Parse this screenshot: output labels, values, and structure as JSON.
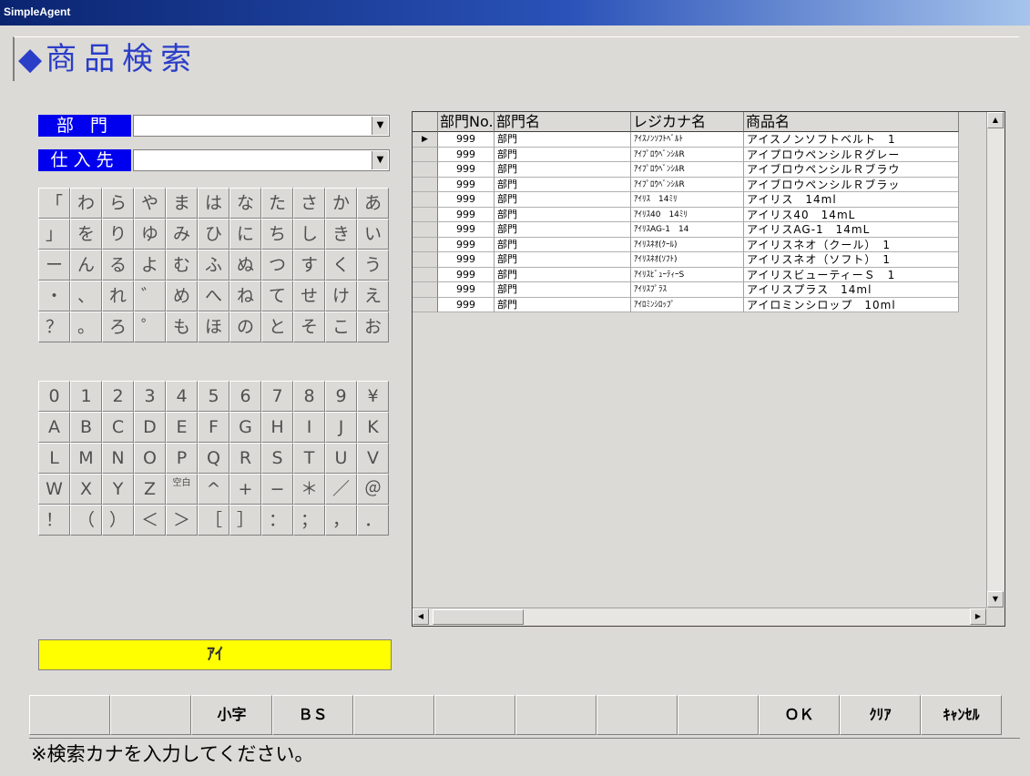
{
  "window": {
    "title": "SimpleAgent"
  },
  "page": {
    "title": "商品検索"
  },
  "filters": {
    "dept_label": "部 門",
    "dept_value": "",
    "supplier_label": "仕入先",
    "supplier_value": ""
  },
  "kana_keys": [
    [
      "「",
      "わ",
      "ら",
      "や",
      "ま",
      "は",
      "な",
      "た",
      "さ",
      "か",
      "あ"
    ],
    [
      "」",
      "を",
      "り",
      "ゆ",
      "み",
      "ひ",
      "に",
      "ち",
      "し",
      "き",
      "い"
    ],
    [
      "ー",
      "ん",
      "る",
      "よ",
      "む",
      "ふ",
      "ぬ",
      "つ",
      "す",
      "く",
      "う"
    ],
    [
      "・",
      "、",
      "れ",
      "゛",
      "め",
      "へ",
      "ね",
      "て",
      "せ",
      "け",
      "え"
    ],
    [
      "？",
      "。",
      "ろ",
      "゜",
      "も",
      "ほ",
      "の",
      "と",
      "そ",
      "こ",
      "お"
    ]
  ],
  "alnum_keys": [
    [
      "0",
      "1",
      "2",
      "3",
      "4",
      "5",
      "6",
      "7",
      "8",
      "9",
      "¥"
    ],
    [
      "A",
      "B",
      "C",
      "D",
      "E",
      "F",
      "G",
      "H",
      "I",
      "J",
      "K"
    ],
    [
      "L",
      "M",
      "N",
      "O",
      "P",
      "Q",
      "R",
      "S",
      "T",
      "U",
      "V"
    ],
    [
      "W",
      "X",
      "Y",
      "Z",
      "空白",
      "^",
      "+",
      "−",
      "＊",
      "／",
      "＠"
    ],
    [
      "！",
      "（",
      "）",
      "＜",
      "＞",
      "［",
      "］",
      "：",
      "；",
      "，",
      "．"
    ]
  ],
  "search_input": "ｱｲ",
  "table": {
    "columns": [
      "部門No.",
      "部門名",
      "レジカナ名",
      "商品名"
    ],
    "rows": [
      {
        "no": "999",
        "dept": "部門",
        "kana": "ｱｲｽﾉﾝｿﾌﾄﾍﾞﾙﾄ",
        "name": "アイスノンソフトベルト　1"
      },
      {
        "no": "999",
        "dept": "部門",
        "kana": "ｱｲﾌﾟﾛｳﾍﾞﾝｼﾙR",
        "name": "アイプロウペンシルＲグレー"
      },
      {
        "no": "999",
        "dept": "部門",
        "kana": "ｱｲﾌﾟﾛｳﾍﾞﾝｼﾙR",
        "name": "アイブロウペンシルＲブラウ"
      },
      {
        "no": "999",
        "dept": "部門",
        "kana": "ｱｲﾌﾟﾛｳﾍﾞﾝｼﾙR",
        "name": "アイブロウペンシルＲブラッ"
      },
      {
        "no": "999",
        "dept": "部門",
        "kana": "ｱｲﾘｽ　14ﾐﾘ",
        "name": "アイリス　14ml"
      },
      {
        "no": "999",
        "dept": "部門",
        "kana": "ｱｲﾘｽ40　14ﾐﾘ",
        "name": "アイリス40　14mL"
      },
      {
        "no": "999",
        "dept": "部門",
        "kana": "ｱｲﾘｽAG-1　14",
        "name": "アイリスAG-1　14mL"
      },
      {
        "no": "999",
        "dept": "部門",
        "kana": "ｱｲﾘｽﾈｵ(ｸｰﾙ)",
        "name": "アイリスネオ（クール）　1"
      },
      {
        "no": "999",
        "dept": "部門",
        "kana": "ｱｲﾘｽﾈｵ(ｿﾌﾄ)",
        "name": "アイリスネオ（ソフト）　1"
      },
      {
        "no": "999",
        "dept": "部門",
        "kana": "ｱｲﾘｽﾋﾞｭｰﾃｨｰS",
        "name": "アイリスビューティーＳ　1"
      },
      {
        "no": "999",
        "dept": "部門",
        "kana": "ｱｲﾘｽﾌﾟﾗｽ",
        "name": "アイリスプラス　14ml"
      },
      {
        "no": "999",
        "dept": "部門",
        "kana": "ｱｲﾛﾐﾝｼﾛｯﾌﾟ",
        "name": "アイロミンシロップ　10ml"
      }
    ]
  },
  "function_buttons": [
    "",
    "",
    "小字",
    "ＢＳ",
    "",
    "",
    "",
    "",
    "",
    "ＯＫ",
    "ｸﾘｱ",
    "ｷｬﾝｾﾙ"
  ],
  "status": "※検索カナを入力してください。",
  "colors": {
    "label_bg": "#0000ee",
    "input_highlight": "#ffff00",
    "title_text": "#2a3ec8"
  }
}
